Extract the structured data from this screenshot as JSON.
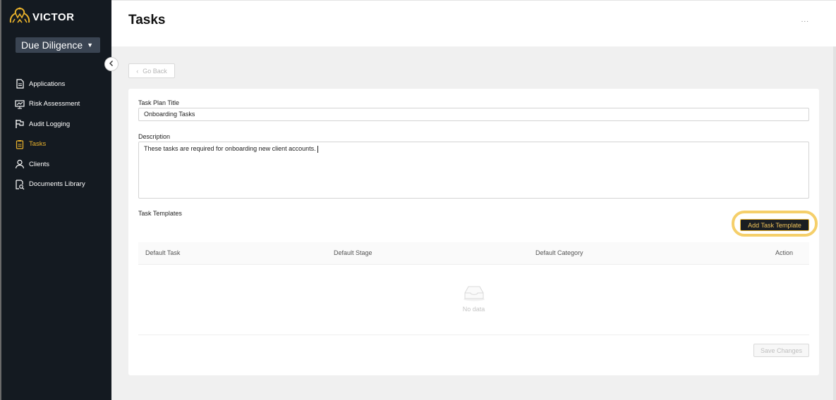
{
  "app": {
    "logo_text": "VICTOR",
    "module": "Due Diligence",
    "accent": "#e9b22c"
  },
  "sidebar": {
    "items": [
      {
        "label": "Applications",
        "icon": "document-icon",
        "active": false
      },
      {
        "label": "Risk Assessment",
        "icon": "presentation-chart-icon",
        "active": false
      },
      {
        "label": "Audit Logging",
        "icon": "flag-icon",
        "active": false
      },
      {
        "label": "Tasks",
        "icon": "clipboard-icon",
        "active": true
      },
      {
        "label": "Clients",
        "icon": "user-icon",
        "active": false
      },
      {
        "label": "Documents Library",
        "icon": "document-search-icon",
        "active": false
      }
    ]
  },
  "header": {
    "title": "Tasks",
    "more": "..."
  },
  "go_back": "Go Back",
  "form": {
    "title_label": "Task Plan Title",
    "title_value": "Onboarding Tasks",
    "description_label": "Description",
    "description_value": "These tasks are required for onboarding new client accounts.",
    "templates_label": "Task Templates",
    "add_button": "Add Task Template",
    "table": {
      "columns": [
        "Default Task",
        "Default Stage",
        "Default Category",
        "Action"
      ],
      "empty_text": "No data"
    },
    "save_button": "Save Changes"
  }
}
